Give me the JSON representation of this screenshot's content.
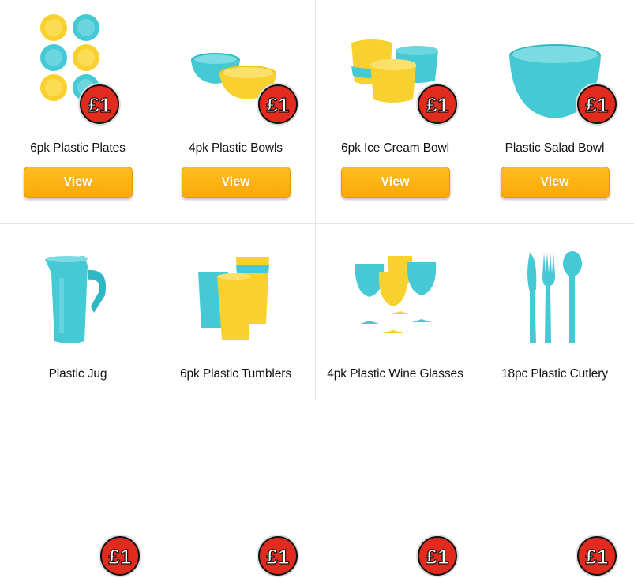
{
  "colors": {
    "cyan": "#45c9d4",
    "yellow": "#f9d12e",
    "button": "#fbb313",
    "badge_red": "#e02b1e"
  },
  "price_badge": "£1",
  "products": [
    {
      "name": "6pk Plastic Plates",
      "button": "View",
      "image_icon": "plates-icon"
    },
    {
      "name": "4pk Plastic Bowls",
      "button": "View",
      "image_icon": "bowls-icon"
    },
    {
      "name": "6pk Ice Cream Bowl",
      "button": "View",
      "image_icon": "ice-cream-bowl-icon"
    },
    {
      "name": "Plastic Salad Bowl",
      "button": "View",
      "image_icon": "salad-bowl-icon"
    },
    {
      "name": "Plastic Jug",
      "image_icon": "jug-icon"
    },
    {
      "name": "6pk Plastic Tumblers",
      "image_icon": "tumblers-icon"
    },
    {
      "name": "4pk Plastic Wine Glasses",
      "image_icon": "wine-glasses-icon"
    },
    {
      "name": "18pc Plastic Cutlery",
      "image_icon": "cutlery-icon"
    }
  ]
}
